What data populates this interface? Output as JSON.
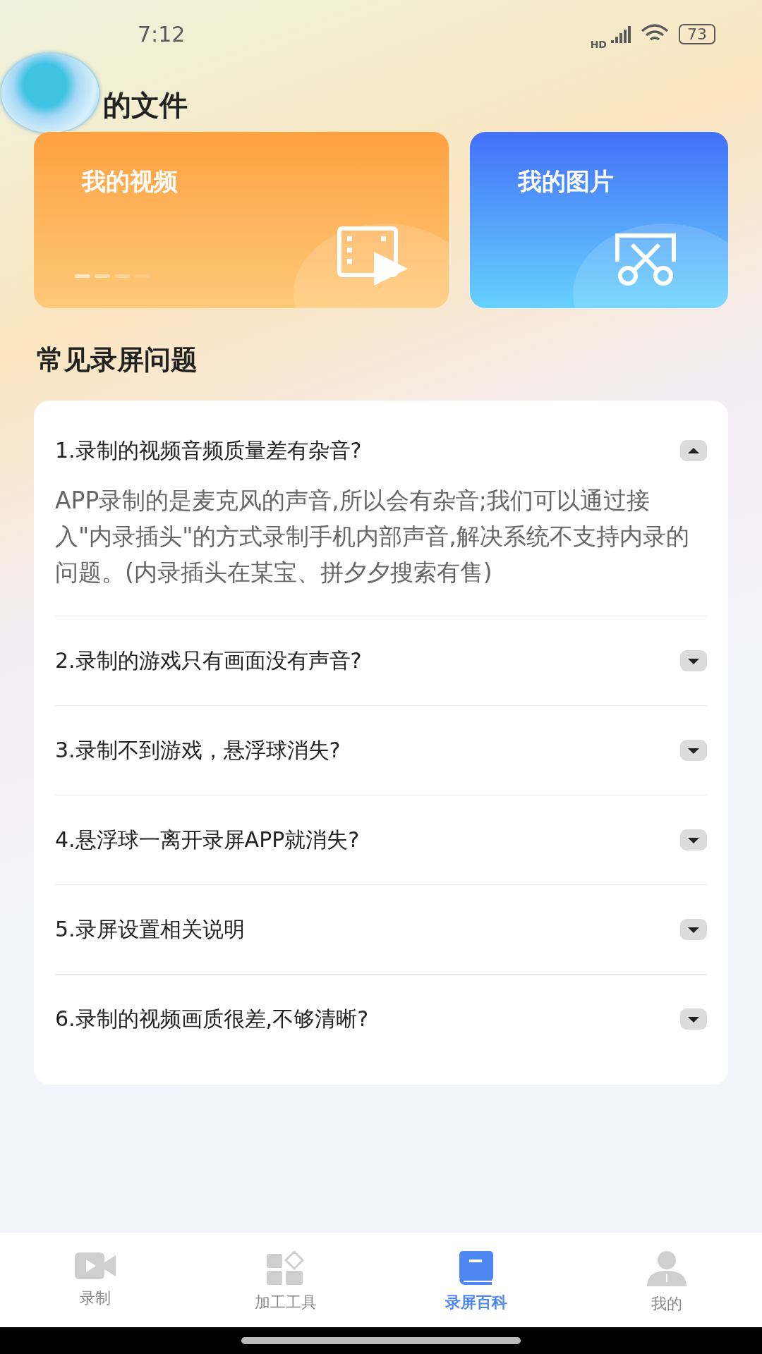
{
  "status_bar": {
    "time": "7:12",
    "network": "HD",
    "battery": "73"
  },
  "files_section": {
    "title": "的文件",
    "cards": [
      {
        "label": "我的视频",
        "kind": "video"
      },
      {
        "label": "我的图片",
        "kind": "image"
      }
    ]
  },
  "faq_section": {
    "title": "常见录屏问题",
    "items": [
      {
        "question": "1.录制的视频音频质量差有杂音?",
        "expanded": true,
        "answer": "APP录制的是麦克风的声音,所以会有杂音;我们可以通过接入\"内录插头\"的方式录制手机内部声音,解决系统不支持内录的问题。(内录插头在某宝、拼夕夕搜索有售)"
      },
      {
        "question": "2.录制的游戏只有画面没有声音?",
        "expanded": false
      },
      {
        "question": "3.录制不到游戏，悬浮球消失?",
        "expanded": false
      },
      {
        "question": "4.悬浮球一离开录屏APP就消失?",
        "expanded": false
      },
      {
        "question": "5.录屏设置相关说明",
        "expanded": false
      },
      {
        "question": "6.录制的视频画质很差,不够清晰?",
        "expanded": false
      }
    ]
  },
  "tab_bar": [
    {
      "label": "录制",
      "kind": "record",
      "selected": false
    },
    {
      "label": "加工工具",
      "kind": "tools",
      "selected": false
    },
    {
      "label": "录屏百科",
      "kind": "wiki",
      "selected": true
    },
    {
      "label": "我的",
      "kind": "profile",
      "selected": false
    }
  ]
}
